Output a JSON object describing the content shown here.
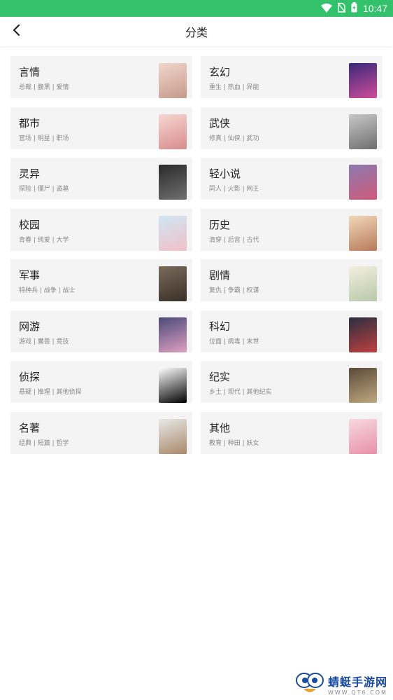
{
  "status_bar": {
    "time": "10:47"
  },
  "header": {
    "title": "分类"
  },
  "categories": [
    {
      "name": "言情",
      "tags": "总裁 | 腹黑 | 爱情",
      "thumb_colors": [
        "#f3d6cc",
        "#c49a8a"
      ]
    },
    {
      "name": "玄幻",
      "tags": "重生 | 热血 | 异能",
      "thumb_colors": [
        "#3a2a7a",
        "#d04a9a"
      ]
    },
    {
      "name": "都市",
      "tags": "官场 | 明星 | 职场",
      "thumb_colors": [
        "#f6d7d2",
        "#d88b8b"
      ]
    },
    {
      "name": "武侠",
      "tags": "修真 | 仙侠 | 武功",
      "thumb_colors": [
        "#c8c8c8",
        "#6e6e6e"
      ]
    },
    {
      "name": "灵异",
      "tags": "探险 | 僵尸 | 盗墓",
      "thumb_colors": [
        "#2a2a2a",
        "#707070"
      ]
    },
    {
      "name": "轻小说",
      "tags": "同人 | 火影 | 网王",
      "thumb_colors": [
        "#8a7ab0",
        "#d05a7a"
      ]
    },
    {
      "name": "校园",
      "tags": "青春 | 纯爱 | 大学",
      "thumb_colors": [
        "#cfe6f3",
        "#f0c0c8"
      ]
    },
    {
      "name": "历史",
      "tags": "清穿 | 后宫 | 古代",
      "thumb_colors": [
        "#f0d8b8",
        "#b87a5a"
      ]
    },
    {
      "name": "军事",
      "tags": "特种兵 | 战争 | 战士",
      "thumb_colors": [
        "#7a6a5a",
        "#3a3028"
      ]
    },
    {
      "name": "剧情",
      "tags": "复仇 | 争霸 | 权谋",
      "thumb_colors": [
        "#f3efe0",
        "#b8c8a8"
      ]
    },
    {
      "name": "网游",
      "tags": "游戏 | 魔兽 | 竞技",
      "thumb_colors": [
        "#4a4a7a",
        "#e0a0c0"
      ]
    },
    {
      "name": "科幻",
      "tags": "位面 | 病毒 | 末世",
      "thumb_colors": [
        "#2a3040",
        "#c04040"
      ]
    },
    {
      "name": "侦探",
      "tags": "悬疑 | 推理 | 其他侦探",
      "thumb_colors": [
        "#ffffff",
        "#000000"
      ]
    },
    {
      "name": "纪实",
      "tags": "乡土 | 现代 | 其他纪实",
      "thumb_colors": [
        "#5a4a38",
        "#c0a880"
      ]
    },
    {
      "name": "名著",
      "tags": "经典 | 短篇 | 哲学",
      "thumb_colors": [
        "#e8e8e8",
        "#a88868"
      ]
    },
    {
      "name": "其他",
      "tags": "教育 | 种田 | 妖女",
      "thumb_colors": [
        "#f7d8e0",
        "#e890a8"
      ]
    }
  ],
  "watermark": {
    "main": "蜻蜓手游网",
    "sub": "WWW.QT6.COM"
  },
  "colors": {
    "status_bar": "#33c16b",
    "card_bg": "#f4f4f4",
    "watermark_blue": "#1a4a9e"
  }
}
